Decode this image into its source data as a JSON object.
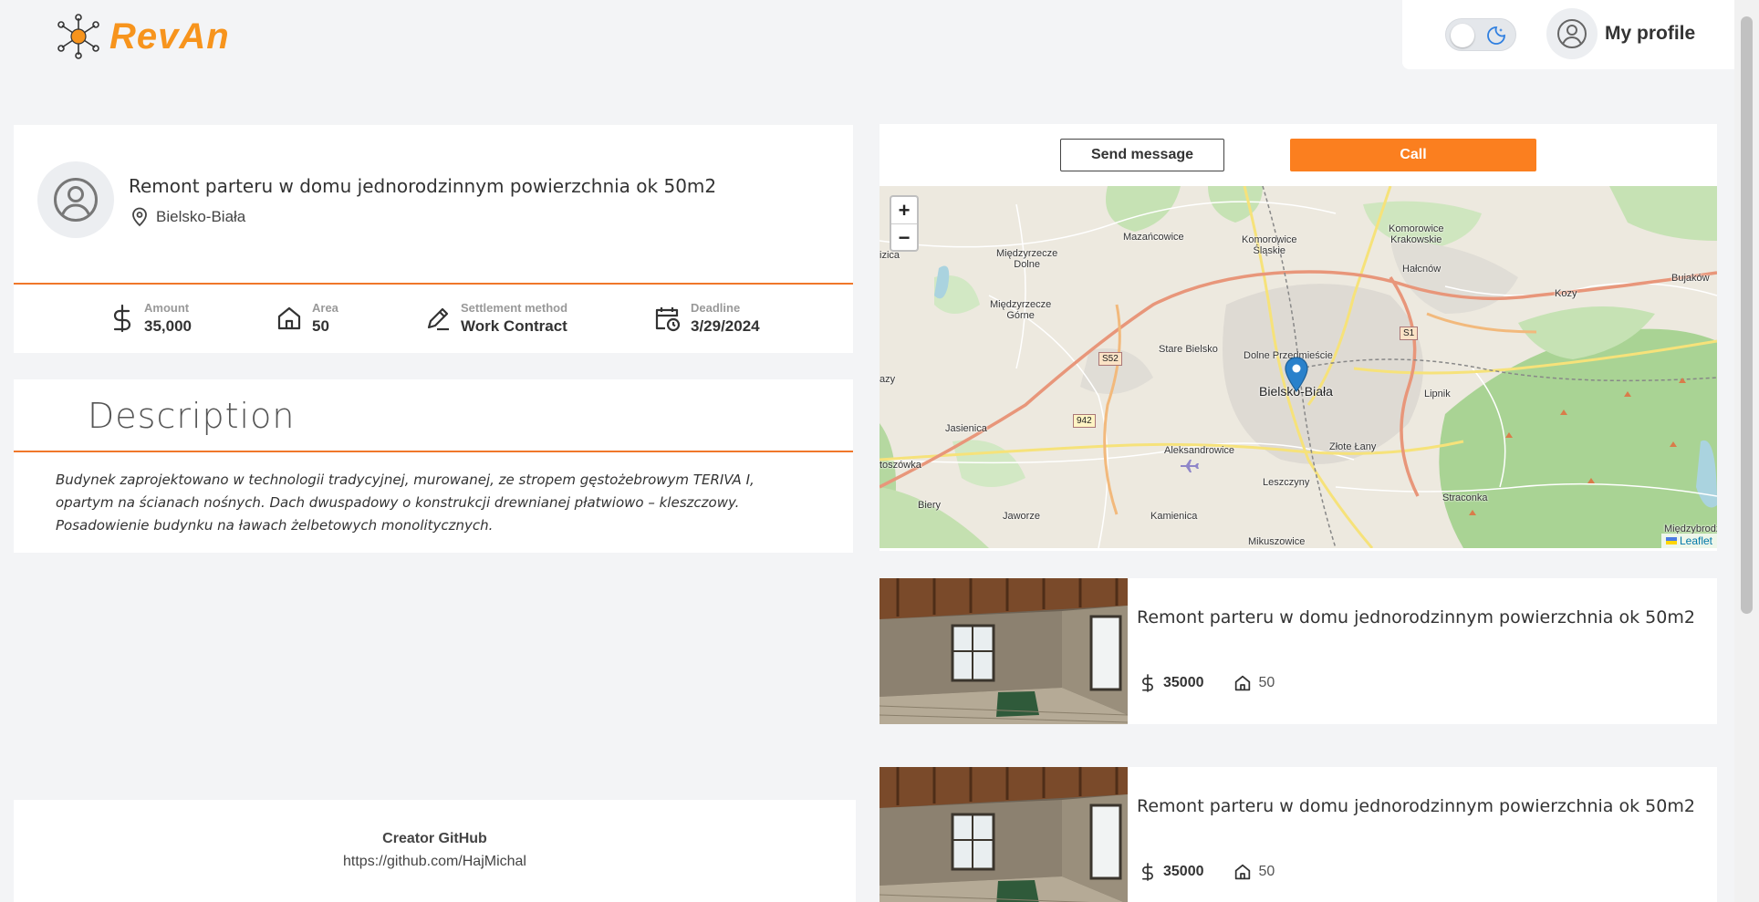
{
  "header": {
    "brand": "RevAn",
    "profile_label": "My profile"
  },
  "offer": {
    "title": "Remont parteru w domu jednorodzinnym powierzchnia ok 50m2",
    "location": "Bielsko-Biała",
    "stats": [
      {
        "label": "Amount",
        "value": "35,000",
        "icon": "dollar-icon"
      },
      {
        "label": "Area",
        "value": "50",
        "icon": "home-icon"
      },
      {
        "label": "Settlement method",
        "value": "Work Contract",
        "icon": "pencil-icon"
      },
      {
        "label": "Deadline",
        "value": "3/29/2024",
        "icon": "calendar-clock-icon"
      }
    ]
  },
  "description": {
    "heading": "Description",
    "text": "Budynek zaprojektowano w technologii tradycyjnej, murowanej, ze stropem gęstożebrowym TERIVA I, opartym na ścianach nośnych. Dach dwuspadowy o konstrukcji drewnianej płatwiowo – kleszczowy. Posadowienie budynku na ławach żelbetowych monolitycznych."
  },
  "actions": {
    "send_message": "Send message",
    "call": "Call"
  },
  "map": {
    "zoom_in": "+",
    "zoom_out": "−",
    "attribution": "Leaflet",
    "labels": {
      "mazancowice": "Mazańcowice",
      "komorowice_slaskie": "Komorowice\nŚląskie",
      "komorowice_krakowskie": "Komorowice\nKrakowskie",
      "miedzyrzecze_dolne": "Międzyrzecze\nDolne",
      "miedzyrzecze_gorne": "Międzyrzecze\nGórne",
      "halcnow": "Hałcnów",
      "bujakow": "Bujaków",
      "kozy": "Kozy",
      "stare_bielsko": "Stare Bielsko",
      "dolne_przedmiescie": "Dolne Przedmieście",
      "bielsko_biala": "Bielsko-Biała",
      "lipnik": "Lipnik",
      "jasienica": "Jasienica",
      "aleksandrowice": "Aleksandrowice",
      "zlote_lany": "Złote Łany",
      "leszczyny": "Leszczyny",
      "straconka": "Straconka",
      "mikuszowice": "Mikuszowice",
      "kamienica": "Kamienica",
      "jaworze": "Jaworze",
      "biery": "Biery",
      "toszowka": "toszówka",
      "izica": "izica",
      "lazy": "azy",
      "miedzybrodz": "Międzybrodz",
      "s52": "S52",
      "s1": "S1",
      "r942": "942"
    }
  },
  "listings": [
    {
      "title": "Remont parteru w domu jednorodzinnym powierzchnia ok 50m2",
      "amount": "35000",
      "area": "50"
    },
    {
      "title": "Remont parteru w domu jednorodzinnym powierzchnia ok 50m2",
      "amount": "35000",
      "area": "50"
    }
  ],
  "footer": {
    "title": "Creator GitHub",
    "link": "https://github.com/HajMichal"
  },
  "colors": {
    "accent": "#fb7f1f",
    "brand": "#f7941d",
    "divider": "#f0772a",
    "background": "#f3f4f6"
  }
}
